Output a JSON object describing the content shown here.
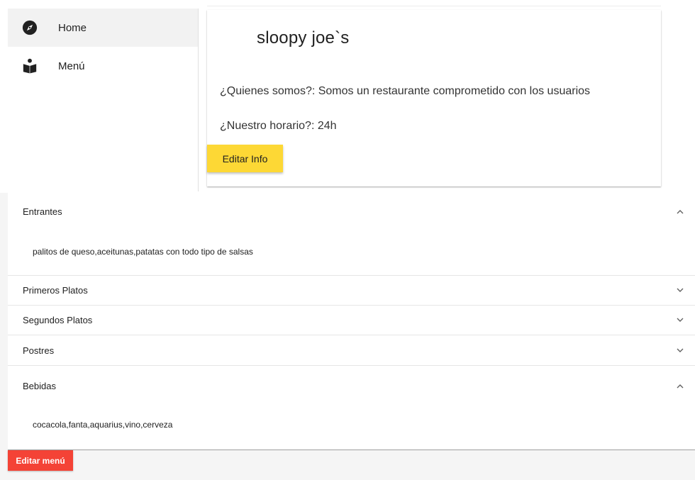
{
  "sidebar": {
    "items": [
      {
        "label": "Home",
        "icon": "compass-icon",
        "active": true
      },
      {
        "label": "Menú",
        "icon": "menu-book-icon",
        "active": false
      }
    ]
  },
  "info_card": {
    "title": "sloopy joe`s",
    "about": "¿Quienes somos?: Somos un restaurante comprometido con los usuarios",
    "hours": "¿Nuestro horario?: 24h",
    "edit_label": "Editar Info"
  },
  "menu": {
    "sections": [
      {
        "title": "Entrantes",
        "expanded": true,
        "content": "palitos de queso,aceitunas,patatas con todo tipo de salsas"
      },
      {
        "title": "Primeros Platos",
        "expanded": false,
        "content": ""
      },
      {
        "title": "Segundos Platos",
        "expanded": false,
        "content": ""
      },
      {
        "title": "Postres",
        "expanded": false,
        "content": ""
      },
      {
        "title": "Bebidas",
        "expanded": true,
        "content": "cocacola,fanta,aquarius,vino,cerveza"
      }
    ],
    "edit_label": "Editar menú"
  },
  "colors": {
    "edit_info_button": "#fdd835",
    "edit_menu_button": "#f44336",
    "active_nav": "#f2f2f2"
  }
}
